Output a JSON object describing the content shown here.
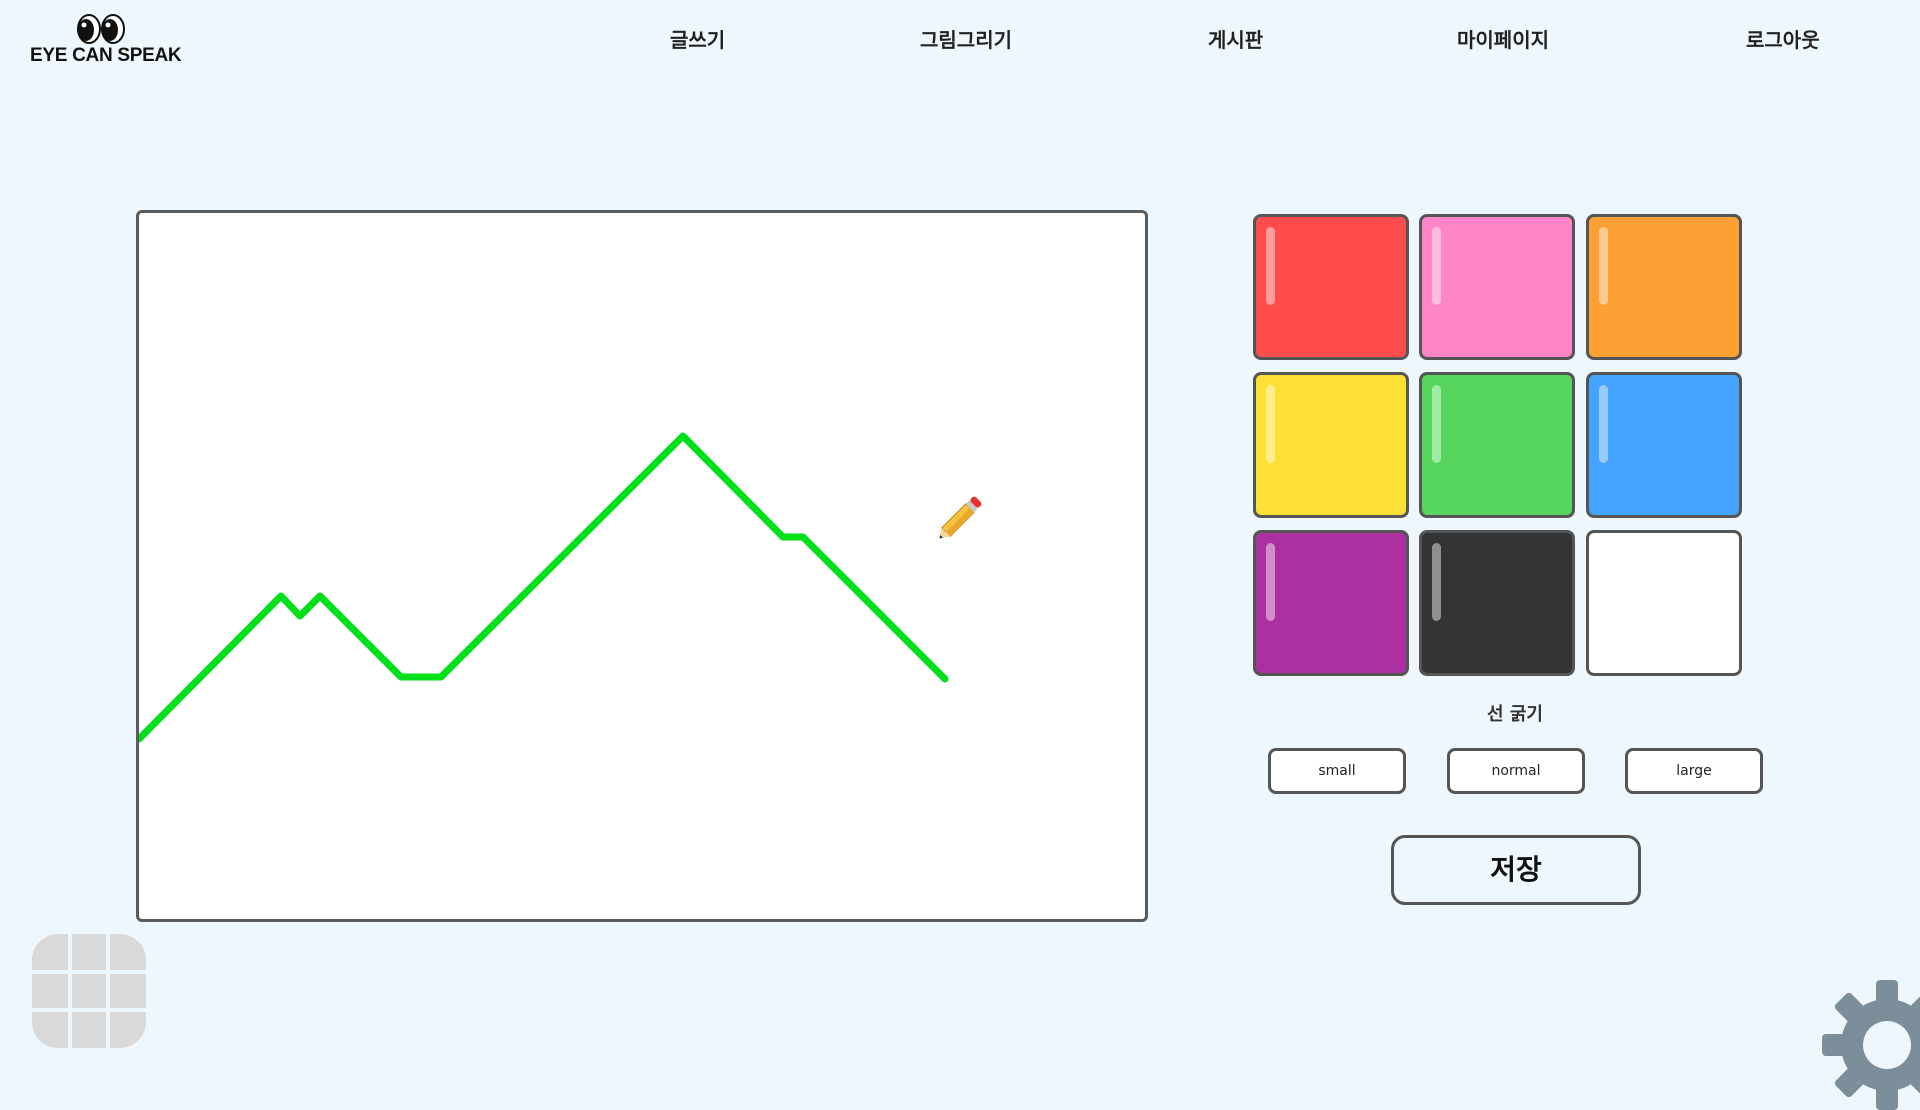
{
  "app": {
    "logo_text": "EYE CAN SPEAK"
  },
  "nav": {
    "items": [
      {
        "label": "글쓰기"
      },
      {
        "label": "그림그리기"
      },
      {
        "label": "게시판"
      },
      {
        "label": "마이페이지"
      },
      {
        "label": "로그아웃"
      }
    ]
  },
  "canvas": {
    "stroke_color": "#00e01a",
    "stroke_thickness": "normal"
  },
  "palette": {
    "colors": [
      {
        "name": "red",
        "hex": "#ff4d4d"
      },
      {
        "name": "pink",
        "hex": "#ff85c8"
      },
      {
        "name": "orange",
        "hex": "#fc9f34"
      },
      {
        "name": "yellow",
        "hex": "#fce034"
      },
      {
        "name": "green",
        "hex": "#57d65d"
      },
      {
        "name": "blue",
        "hex": "#44a3fc"
      },
      {
        "name": "purple",
        "hex": "#ad30a1"
      },
      {
        "name": "black",
        "hex": "#323436"
      },
      {
        "name": "white",
        "hex": "#ffffff"
      }
    ]
  },
  "thickness": {
    "title": "선 굵기",
    "options": [
      "small",
      "normal",
      "large"
    ]
  },
  "actions": {
    "save_label": "저장"
  },
  "icons": {
    "logo": "eyes-logo-icon",
    "cursor": "pencil-icon",
    "menu": "grid-menu-icon",
    "settings": "gear-icon"
  }
}
